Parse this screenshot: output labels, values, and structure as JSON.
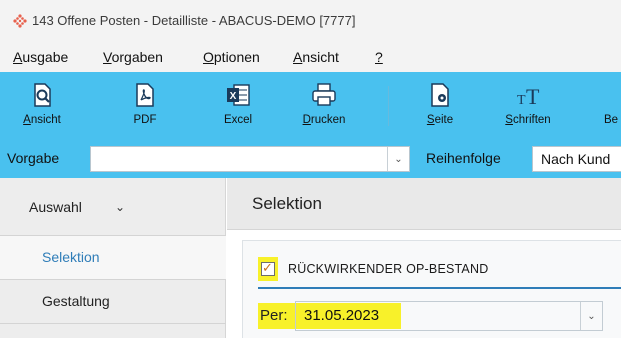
{
  "window": {
    "title": "143 Offene Posten - Detailliste - ABACUS-DEMO [7777]",
    "app_icon": "abacus-diamond-icon"
  },
  "menu": [
    {
      "label": "Ausgabe",
      "mnemonic": "A",
      "rest": "usgabe"
    },
    {
      "label": "Vorgaben",
      "mnemonic": "V",
      "rest": "orgaben"
    },
    {
      "label": "Optionen",
      "mnemonic": "O",
      "rest": "ptionen"
    },
    {
      "label": "Ansicht",
      "mnemonic": "A",
      "rest": "nsicht"
    },
    {
      "label": "?",
      "mnemonic": "?",
      "rest": ""
    }
  ],
  "toolbar": {
    "buttons": [
      {
        "label": "Ansicht",
        "mnemonic": "A",
        "rest": "nsicht",
        "icon": "preview-icon"
      },
      {
        "label": "PDF",
        "mnemonic": "",
        "rest": "PDF",
        "icon": "pdf-icon"
      },
      {
        "label": "Excel",
        "mnemonic": "",
        "rest": "Excel",
        "icon": "excel-icon"
      },
      {
        "label": "Drucken",
        "mnemonic": "D",
        "rest": "rucken",
        "icon": "printer-icon"
      },
      {
        "label": "Seite",
        "mnemonic": "S",
        "rest": "eite",
        "icon": "page-settings-icon"
      },
      {
        "label": "Schriften",
        "mnemonic": "S",
        "rest": "chriften",
        "icon": "fonts-icon"
      },
      {
        "label": "Be",
        "mnemonic": "",
        "rest": "Be",
        "icon": ""
      }
    ]
  },
  "options_bar": {
    "vorgabe_label": "Vorgabe",
    "vorgabe_value": "",
    "reihenfolge_label": "Reihenfolge",
    "reihenfolge_value": "Nach Kund"
  },
  "sidebar": {
    "dropdown_label": "Auswahl",
    "items": [
      {
        "label": "Selektion",
        "active": true
      },
      {
        "label": "Gestaltung",
        "active": false
      }
    ]
  },
  "main": {
    "title": "Selektion",
    "checkbox_label": "RÜCKWIRKENDER OP-BESTAND",
    "checkbox_checked": true,
    "per_label": "Per:",
    "per_value": "31.05.2023"
  },
  "colors": {
    "ribbon": "#49c1ef",
    "highlight": "#f8f12a",
    "accent_blue": "#2f7db8"
  }
}
